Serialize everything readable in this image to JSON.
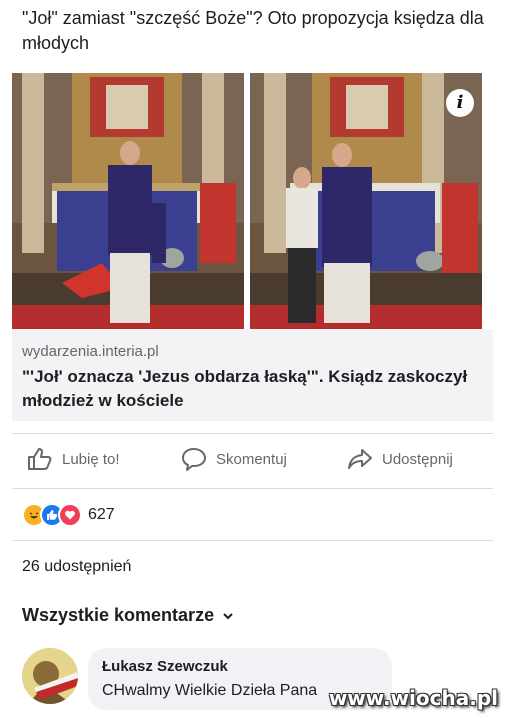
{
  "post": {
    "text": "\"Joł\" zamiast \"szczęść Boże\"? Oto propozycja księdza dla młodych"
  },
  "photos": [
    {
      "label": "priest-speaking-photo"
    },
    {
      "label": "priest-blessing-photo"
    }
  ],
  "link": {
    "domain": "wydarzenia.interia.pl",
    "title": "\"'Joł' oznacza 'Jezus obdarza łaską'\". Ksiądz zaskoczył młodzież w kościele",
    "info_glyph": "i"
  },
  "actions": {
    "like": "Lubię to!",
    "comment": "Skomentuj",
    "share": "Udostępnij"
  },
  "reactions": {
    "count": "627",
    "types": [
      "haha",
      "like",
      "love"
    ],
    "colors": {
      "haha": "#f7b125",
      "like": "#1877f2",
      "love": "#f33e58"
    }
  },
  "shares": "26 udostępnień",
  "comments": {
    "header": "Wszystkie komentarze",
    "items": [
      {
        "author": "Łukasz Szewczuk",
        "text": "CHwalmy Wielkie Dzieła Pana"
      }
    ]
  },
  "watermark": "www.wiocha.pl"
}
